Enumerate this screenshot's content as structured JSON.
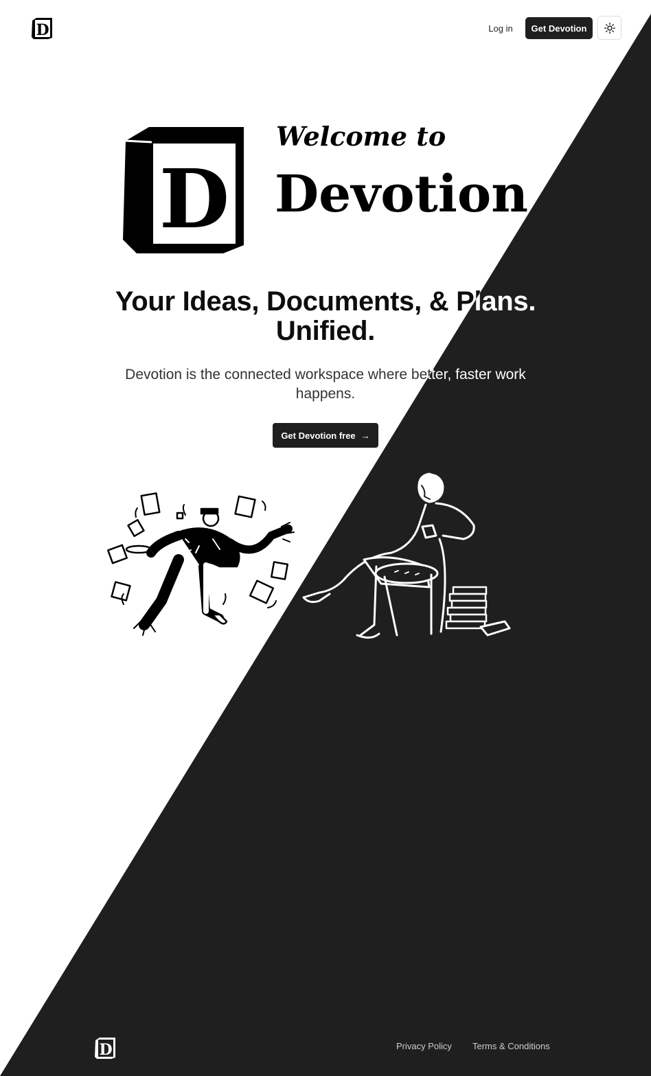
{
  "colors": {
    "background_light": "#ffffff",
    "background_dark": "#1f1f1f",
    "primary": "#1f1f1f",
    "text_on_dark": "#ffffff",
    "footer_link": "#cfcfcf"
  },
  "header": {
    "logo_icon": "devotion-logo-icon",
    "login_label": "Log in",
    "get_devotion_label": "Get Devotion",
    "theme_toggle_icon": "sun-icon"
  },
  "hero": {
    "welcome": "Welcome to",
    "brand": "Devotion",
    "logo_letter": "D",
    "headline_line1": "Your Ideas, Documents, & Plans.",
    "headline_line2": "Unified.",
    "subtext": "Devotion is the connected workspace where better, faster work happens.",
    "cta_label": "Get Devotion free",
    "cta_icon": "arrow-right-icon"
  },
  "illustrations": {
    "left": "juggling-papers-illustration",
    "right": "reading-in-chair-illustration"
  },
  "footer": {
    "logo_icon": "devotion-logo-icon",
    "privacy_label": "Privacy Policy",
    "terms_label": "Terms & Conditions"
  }
}
